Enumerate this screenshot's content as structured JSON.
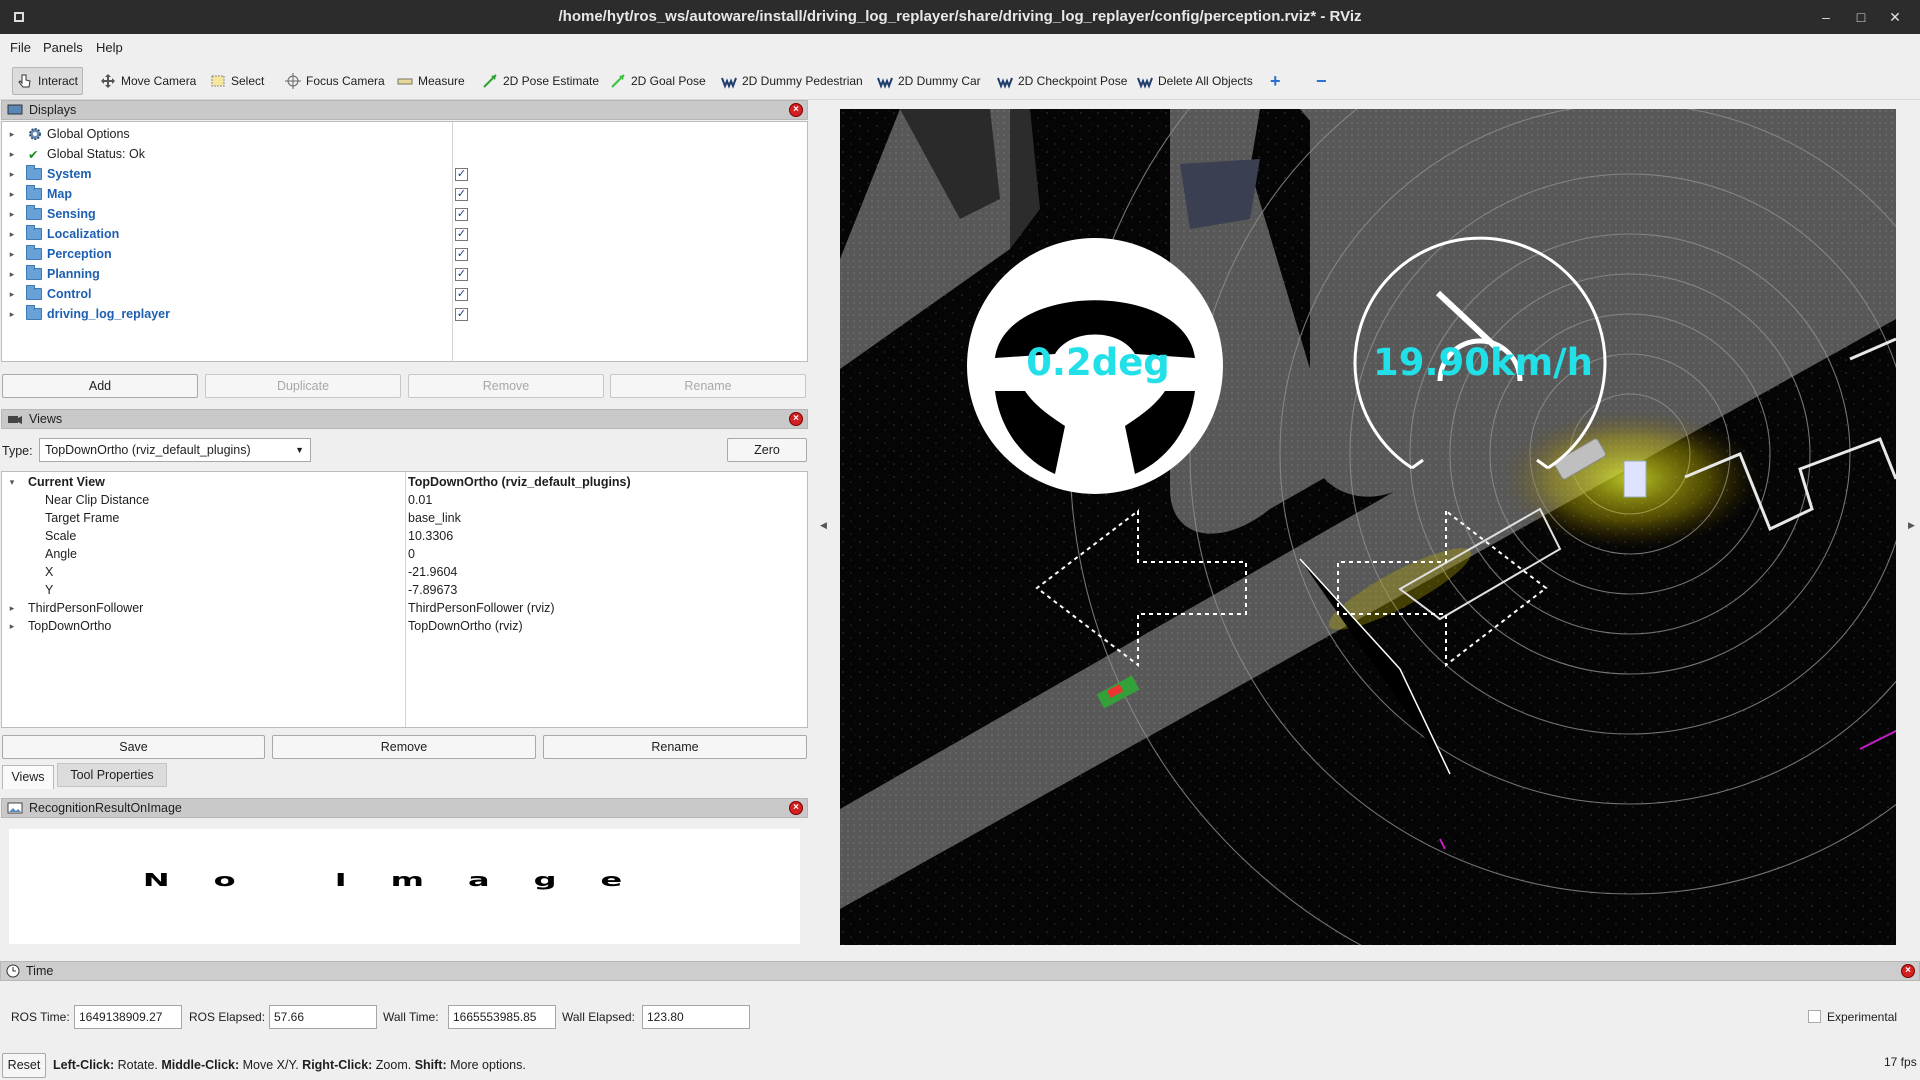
{
  "window": {
    "title": "/home/hyt/ros_ws/autoware/install/driving_log_replayer/share/driving_log_replayer/config/perception.rviz* - RViz",
    "minimize": "–",
    "maximize": "□",
    "close": "✕"
  },
  "menu": [
    "File",
    "Panels",
    "Help"
  ],
  "toolbar": {
    "tools": [
      {
        "label": "Interact",
        "icon": "interact-icon"
      },
      {
        "label": "Move Camera",
        "icon": "move-camera-icon"
      },
      {
        "label": "Select",
        "icon": "select-icon"
      },
      {
        "label": "Focus Camera",
        "icon": "focus-camera-icon"
      },
      {
        "label": "Measure",
        "icon": "measure-icon"
      },
      {
        "label": "2D Pose Estimate",
        "icon": "pose-estimate-icon"
      },
      {
        "label": "2D Goal Pose",
        "icon": "goal-pose-icon"
      },
      {
        "label": "2D Dummy Pedestrian",
        "icon": "autoware-icon"
      },
      {
        "label": "2D Dummy Car",
        "icon": "autoware-icon"
      },
      {
        "label": "2D Checkpoint Pose",
        "icon": "autoware-icon"
      },
      {
        "label": "Delete All Objects",
        "icon": "autoware-icon"
      }
    ],
    "add_tool": "+",
    "remove_tool": "−"
  },
  "displays": {
    "title": "Displays",
    "items": [
      {
        "label": "Global Options",
        "type": "gear"
      },
      {
        "label": "Global Status: Ok",
        "type": "check"
      },
      {
        "label": "System",
        "type": "folder",
        "checked": true
      },
      {
        "label": "Map",
        "type": "folder",
        "checked": true
      },
      {
        "label": "Sensing",
        "type": "folder",
        "checked": true
      },
      {
        "label": "Localization",
        "type": "folder",
        "checked": true
      },
      {
        "label": "Perception",
        "type": "folder",
        "checked": true
      },
      {
        "label": "Planning",
        "type": "folder",
        "checked": true
      },
      {
        "label": "Control",
        "type": "folder",
        "checked": true
      },
      {
        "label": "driving_log_replayer",
        "type": "folder",
        "checked": true
      }
    ],
    "buttons": {
      "add": "Add",
      "duplicate": "Duplicate",
      "remove": "Remove",
      "rename": "Rename"
    }
  },
  "views": {
    "title": "Views",
    "type_label": "Type:",
    "type_value": "TopDownOrtho (rviz_default_plugins)",
    "zero": "Zero",
    "properties": [
      {
        "name": "Current View",
        "value": "TopDownOrtho (rviz_default_plugins)",
        "level": 0,
        "expanded": true,
        "bold": true
      },
      {
        "name": "Near Clip Distance",
        "value": "0.01",
        "level": 1
      },
      {
        "name": "Target Frame",
        "value": "base_link",
        "level": 1
      },
      {
        "name": "Scale",
        "value": "10.3306",
        "level": 1
      },
      {
        "name": "Angle",
        "value": "0",
        "level": 1
      },
      {
        "name": "X",
        "value": "-21.9604",
        "level": 1
      },
      {
        "name": "Y",
        "value": "-7.89673",
        "level": 1
      },
      {
        "name": "ThirdPersonFollower",
        "value": "ThirdPersonFollower (rviz)",
        "level": 0,
        "expandable": true
      },
      {
        "name": "TopDownOrtho",
        "value": "TopDownOrtho (rviz)",
        "level": 0,
        "expandable": true
      }
    ],
    "buttons": {
      "save": "Save",
      "remove": "Remove",
      "rename": "Rename"
    },
    "tabs": [
      "Views",
      "Tool Properties"
    ]
  },
  "recognition": {
    "title": "RecognitionResultOnImage",
    "placeholder": "No Image"
  },
  "viewport": {
    "steering": "0.2deg",
    "speed": "19.90km/h",
    "overlay_color": "#22e0e8"
  },
  "time": {
    "title": "Time",
    "ros_time_label": "ROS Time:",
    "ros_time": "1649138909.27",
    "ros_elapsed_label": "ROS Elapsed:",
    "ros_elapsed": "57.66",
    "wall_time_label": "Wall Time:",
    "wall_time": "1665553985.85",
    "wall_elapsed_label": "Wall Elapsed:",
    "wall_elapsed": "123.80",
    "experimental": "Experimental"
  },
  "statusbar": {
    "reset": "Reset",
    "hint_1_key": "Left-Click:",
    "hint_1": " Rotate. ",
    "hint_2_key": "Middle-Click:",
    "hint_2": " Move X/Y. ",
    "hint_3_key": "Right-Click:",
    "hint_3": " Zoom. ",
    "hint_4_key": "Shift:",
    "hint_4": " More options.",
    "fps": "17 fps"
  }
}
